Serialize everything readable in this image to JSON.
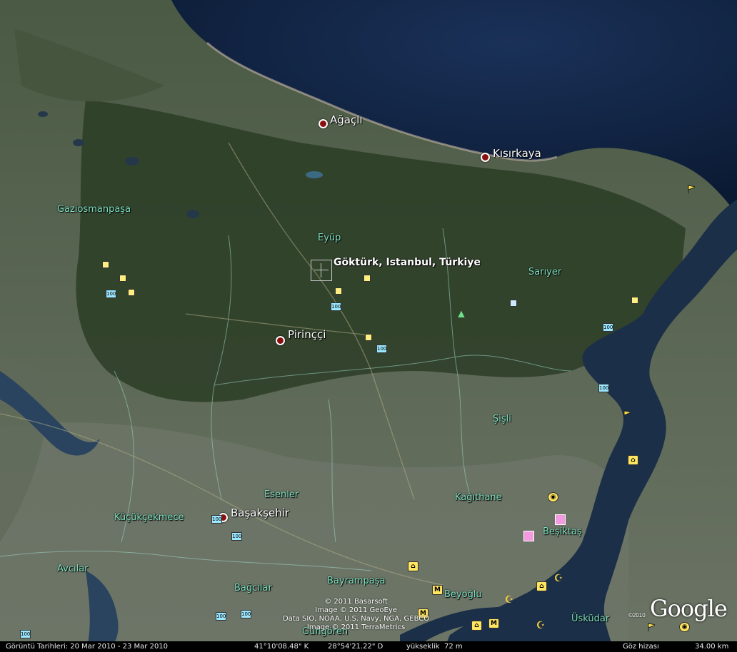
{
  "places": {
    "agacli": "Ağaçlı",
    "kisirkaya": "Kısırkaya",
    "gaziosmanpasa": "Gaziosmanpaşa",
    "eyup": "Eyüp",
    "search_result": "Göktürk, Istanbul, Türkiye",
    "sariyer": "Sarıyer",
    "pirincci": "Pirinççi",
    "sisli": "Şişli",
    "esenler": "Esenler",
    "kagithane": "Kağıthane",
    "kucukcekmece": "Küçükçekmece",
    "basaksehir": "Başakşehir",
    "besiktas": "Beşiktaş",
    "avcilar": "Avcılar",
    "bayrampasa": "Bayrampaşa",
    "bagcilar": "Bağcılar",
    "beyoglu": "Beyoğlu",
    "uskudar": "Üsküdar",
    "gungoren": "Güngören"
  },
  "poi": {
    "label_100": "100",
    "museum_glyph": "M",
    "mosque_glyph": "☪",
    "tree_glyph": "▲"
  },
  "credits": {
    "line1": "© 2011 Basarsoft",
    "line2": "Image © 2011 GeoEye",
    "line3": "Data SIO, NOAA, U.S. Navy, NGA, GEBCO",
    "line4": "Image © 2011 TerraMetrics"
  },
  "logo": {
    "text": "Google",
    "year": "©2010"
  },
  "status": {
    "imagery_date": "Görüntü Tarihleri: 20 Mar 2010 - 23 Mar 2010",
    "latitude": "41°10'08.48\" K",
    "longitude": "28°54'21.22\" D",
    "elevation_label": "yükseklik",
    "elevation_value": "72 m",
    "eye_alt_label": "Göz hizası",
    "eye_alt_value": "34.00 km"
  },
  "colors": {
    "sea": "#0f2240",
    "land": "#3a4a34",
    "forest": "#2c3d26",
    "urban": "#6e7668",
    "district_label": "#7fe0c0",
    "place_dot": "#8a1010"
  }
}
